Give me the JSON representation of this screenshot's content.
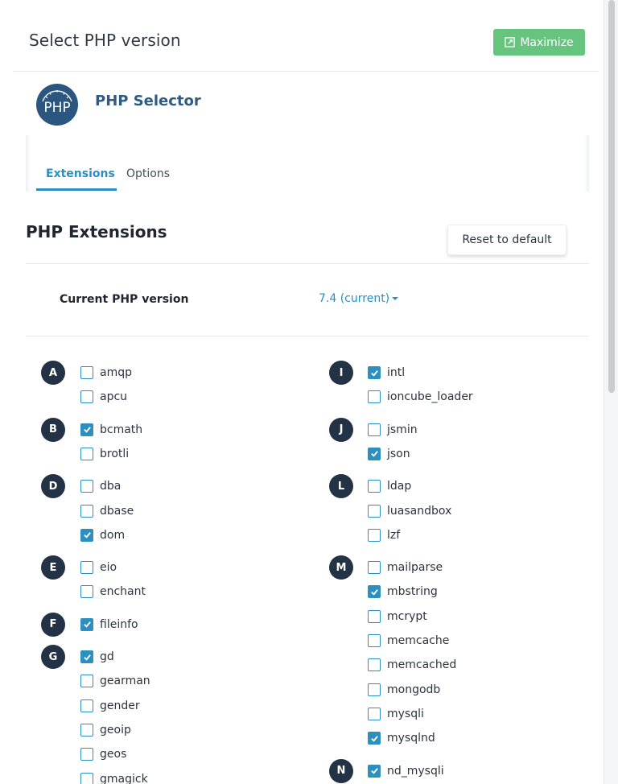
{
  "header": {
    "title": "Select PHP version",
    "maximize_label": "Maximize"
  },
  "app": {
    "name": "PHP Selector",
    "logo_text": "PHP"
  },
  "tabs": [
    {
      "label": "Extensions",
      "active": true
    },
    {
      "label": "Options",
      "active": false
    }
  ],
  "section": {
    "title": "PHP Extensions",
    "reset_label": "Reset to default"
  },
  "version": {
    "label": "Current PHP version",
    "value": "7.4 (current)"
  },
  "colors": {
    "accent": "#2c8fbf",
    "maximize": "#66c47f",
    "badge": "#233245",
    "app_name": "#2f5a82"
  },
  "extensions_left": [
    {
      "letter": "A",
      "items": [
        {
          "name": "amqp",
          "checked": false
        },
        {
          "name": "apcu",
          "checked": false
        }
      ]
    },
    {
      "letter": "B",
      "items": [
        {
          "name": "bcmath",
          "checked": true
        },
        {
          "name": "brotli",
          "checked": false
        }
      ]
    },
    {
      "letter": "D",
      "items": [
        {
          "name": "dba",
          "checked": false
        },
        {
          "name": "dbase",
          "checked": false
        },
        {
          "name": "dom",
          "checked": true
        }
      ]
    },
    {
      "letter": "E",
      "items": [
        {
          "name": "eio",
          "checked": false
        },
        {
          "name": "enchant",
          "checked": false
        }
      ]
    },
    {
      "letter": "F",
      "items": [
        {
          "name": "fileinfo",
          "checked": true
        }
      ]
    },
    {
      "letter": "G",
      "items": [
        {
          "name": "gd",
          "checked": true
        },
        {
          "name": "gearman",
          "checked": false
        },
        {
          "name": "gender",
          "checked": false
        },
        {
          "name": "geoip",
          "checked": false
        },
        {
          "name": "geos",
          "checked": false
        },
        {
          "name": "gmagick",
          "checked": false
        }
      ]
    }
  ],
  "extensions_right": [
    {
      "letter": "I",
      "items": [
        {
          "name": "intl",
          "checked": true
        },
        {
          "name": "ioncube_loader",
          "checked": false
        }
      ]
    },
    {
      "letter": "J",
      "items": [
        {
          "name": "jsmin",
          "checked": false
        },
        {
          "name": "json",
          "checked": true
        }
      ]
    },
    {
      "letter": "L",
      "items": [
        {
          "name": "ldap",
          "checked": false
        },
        {
          "name": "luasandbox",
          "checked": false
        },
        {
          "name": "lzf",
          "checked": false
        }
      ]
    },
    {
      "letter": "M",
      "items": [
        {
          "name": "mailparse",
          "checked": false
        },
        {
          "name": "mbstring",
          "checked": true
        },
        {
          "name": "mcrypt",
          "checked": false
        },
        {
          "name": "memcache",
          "checked": false
        },
        {
          "name": "memcached",
          "checked": false
        },
        {
          "name": "mongodb",
          "checked": false
        },
        {
          "name": "mysqli",
          "checked": false
        },
        {
          "name": "mysqlnd",
          "checked": true
        }
      ]
    },
    {
      "letter": "N",
      "items": [
        {
          "name": "nd_mysqli",
          "checked": true
        }
      ]
    }
  ]
}
